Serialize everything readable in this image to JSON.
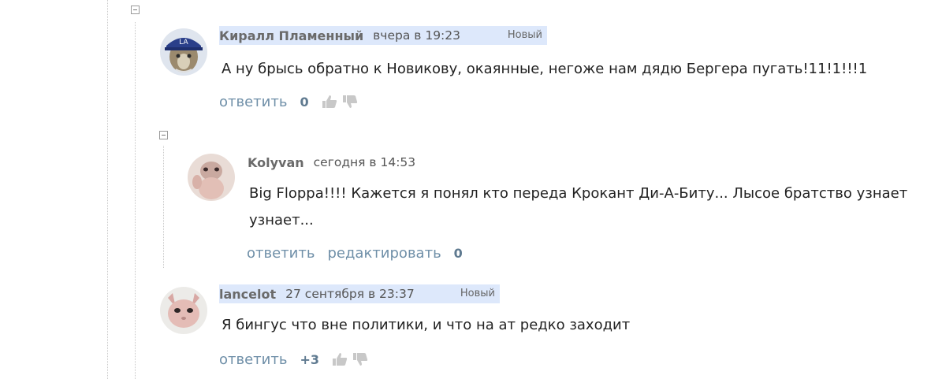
{
  "comments": [
    {
      "author": "Киралл Пламенный",
      "date": "вчера в 19:23",
      "badge": "Новый",
      "text": "А ну брысь обратно к Новикову, окаянные, негоже нам дядю Бергера пугать!11!1!!!1",
      "reply": "ответить",
      "score": "0",
      "avatar": "cat-in-cap-avatar"
    },
    {
      "author": "Kolyvan",
      "date": "сегодня в 14:53",
      "text": "Big Floppa!!!! Кажется я понял кто переда Крокант Ди-А-Биту... Лысое братство узнает узнает...",
      "reply": "ответить",
      "edit": "редактировать",
      "score": "0",
      "avatar": "hairless-cat-avatar"
    },
    {
      "author": "lancelot",
      "date": "27 сентября в 23:37",
      "badge": "Новый",
      "text": "Я бингус что вне политики, и что на ат редко заходит",
      "reply": "ответить",
      "score": "+3",
      "avatar": "sphynx-cat-avatar"
    }
  ],
  "colors": {
    "link": "#6f8fa8",
    "highlight": "#dde8fb",
    "score": "#5f7a90"
  }
}
